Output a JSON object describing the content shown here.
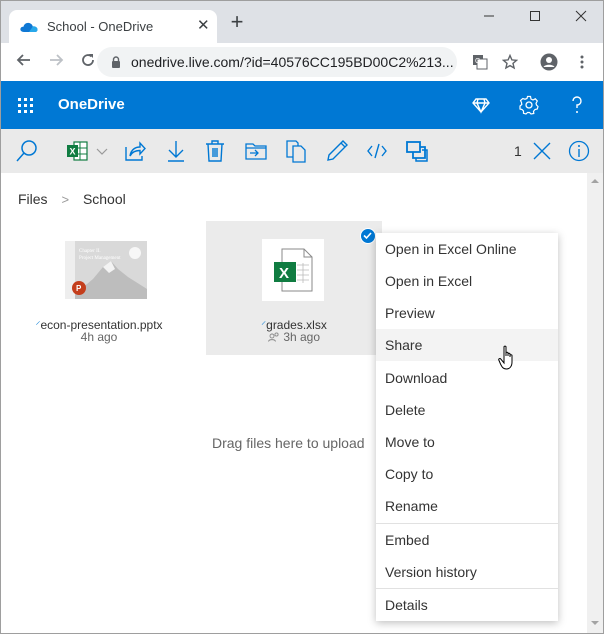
{
  "browser": {
    "tab_title": "School - OneDrive",
    "new_tab_label": "+",
    "url": "onedrive.live.com/?id=40576CC195BD00C2%213...",
    "window_controls": [
      "minimize",
      "maximize",
      "close"
    ]
  },
  "app": {
    "title": "OneDrive",
    "header_icons": [
      "premium-diamond-icon",
      "settings-gear-icon",
      "help-icon"
    ]
  },
  "commandbar": {
    "commands": [
      "search",
      "open-in-excel",
      "share",
      "download",
      "delete",
      "move-to",
      "copy-to",
      "rename",
      "embed",
      "version-history"
    ],
    "selection_count": "1"
  },
  "breadcrumb": {
    "items": [
      "Files",
      "School"
    ],
    "separator": ">"
  },
  "files": [
    {
      "name": "econ-presentation.pptx",
      "meta": "4h ago",
      "type": "pptx",
      "selected": false,
      "shared": false,
      "thumb_title": "Chapter II. Project Management"
    },
    {
      "name": "grades.xlsx",
      "meta": "3h ago",
      "type": "xlsx",
      "selected": true,
      "shared": true
    }
  ],
  "empty_hint": "Drag files here to upload",
  "context_menu": {
    "items": [
      "Open in Excel Online",
      "Open in Excel",
      "Preview",
      "Share",
      "Download",
      "Delete",
      "Move to",
      "Copy to",
      "Rename",
      "Embed",
      "Version history",
      "Details"
    ],
    "hovered": "Share"
  },
  "colors": {
    "brand": "#0078d4",
    "excel_green": "#107c41",
    "ppt_orange": "#c43e1c"
  }
}
